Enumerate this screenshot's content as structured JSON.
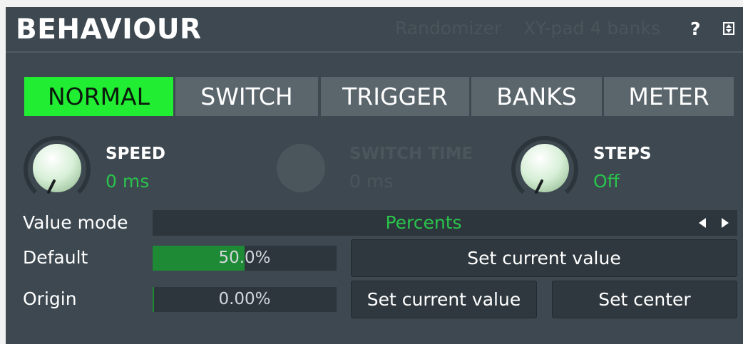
{
  "header": {
    "title": "BEHAVIOUR",
    "links": [
      "Randomizer",
      "XY-pad 4 banks"
    ],
    "help_glyph": "?",
    "icons": [
      "help-icon",
      "expand-icon"
    ]
  },
  "tabs": [
    {
      "label": "NORMAL",
      "active": true
    },
    {
      "label": "SWITCH",
      "active": false
    },
    {
      "label": "TRIGGER",
      "active": false
    },
    {
      "label": "BANKS",
      "active": false
    },
    {
      "label": "METER",
      "active": false
    }
  ],
  "knobs": [
    {
      "label": "SPEED",
      "value": "0 ms",
      "enabled": true
    },
    {
      "label": "SWITCH TIME",
      "value": "0 ms",
      "enabled": false
    },
    {
      "label": "STEPS",
      "value": "Off",
      "enabled": true
    }
  ],
  "value_mode": {
    "label": "Value mode",
    "value": "Percents"
  },
  "default": {
    "label": "Default",
    "value": "50.0%",
    "fraction": 0.5,
    "button": "Set current value"
  },
  "origin": {
    "label": "Origin",
    "value": "0.00%",
    "fraction": 0.0,
    "buttons": [
      "Set current value",
      "Set center"
    ]
  },
  "colors": {
    "accent": "#21ee33",
    "value_text": "#29c44c",
    "panel": "#3d4850",
    "fill": "#1f8a36"
  }
}
